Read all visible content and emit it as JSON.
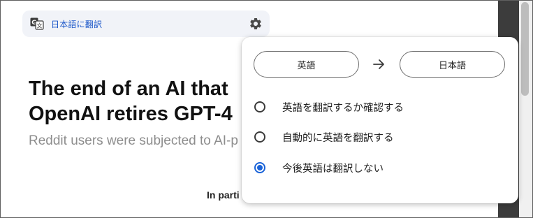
{
  "translate_bar": {
    "label": "日本語に翻訳",
    "icons": {
      "translate": "translate-icon",
      "settings": "gear-icon"
    },
    "label_color": "#1a56c9"
  },
  "article": {
    "headline_line1": "The end of an AI that",
    "headline_line2": "OpenAI retires GPT-4",
    "subhead": "Reddit users were subjected to AI-p",
    "body_partial": "In parti"
  },
  "translate_popup": {
    "source_language": "英語",
    "target_language": "日本語",
    "arrow_icon": "arrow-right-icon",
    "options": [
      {
        "label": "英語を翻訳するか確認する",
        "selected": false
      },
      {
        "label": "自動的に英語を翻訳する",
        "selected": false
      },
      {
        "label": "今後英語は翻訳しない",
        "selected": true
      }
    ],
    "accent_color": "#1a63d8"
  }
}
